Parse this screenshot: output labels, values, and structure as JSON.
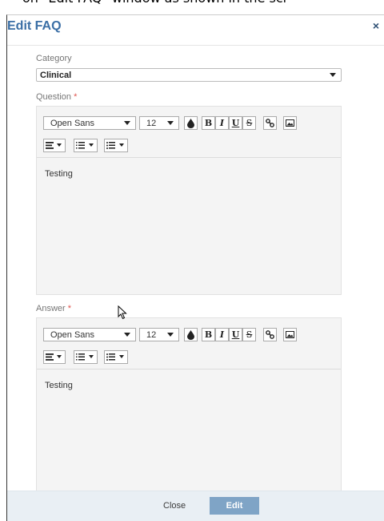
{
  "doc_text_partial": "on \"Edit FAQ\" window as shown in the scr",
  "modal": {
    "title": "Edit FAQ",
    "close_icon": "×",
    "category_label": "Category",
    "category_value": "Clinical",
    "question_label": "Question",
    "answer_label": "Answer",
    "required_marker": "*"
  },
  "editor": {
    "font_name": "Open Sans",
    "font_size": "12",
    "bold": "B",
    "italic": "I",
    "underline": "U",
    "strike": "S"
  },
  "question_content": "Testing",
  "answer_content": "Testing",
  "footer": {
    "close_label": "Close",
    "edit_label": "Edit"
  }
}
